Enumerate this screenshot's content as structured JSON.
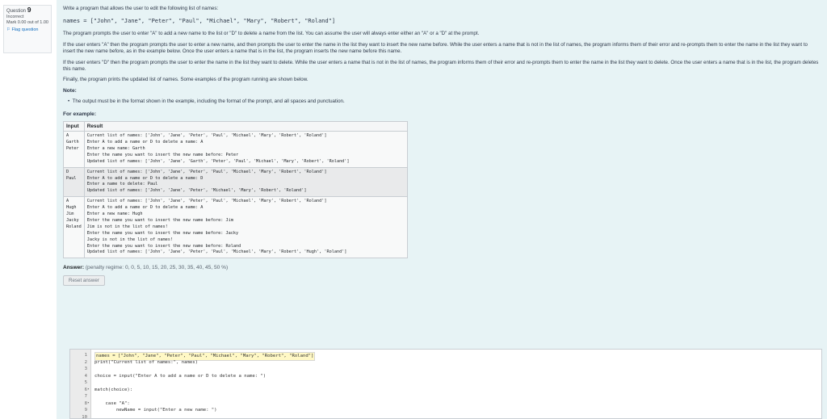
{
  "question_info": {
    "label": "Question",
    "number": "9",
    "status": "Incorrect",
    "mark": "Mark 0.00 out of 1.00",
    "flag_label": "Flag question"
  },
  "question": {
    "intro": "Write a program that allows the user to edit the following list of names:",
    "names_code": "names = [\"John\", \"Jane\", \"Peter\", \"Paul\", \"Michael\", \"Mary\", \"Robert\", \"Roland\"]",
    "para1": "The program prompts the user to enter \"A\" to add a new name to the list or \"D\" to delete a name from the list. You can assume the user will always enter either an \"A\" or a \"D\" at the prompt.",
    "para2": "If the user enters \"A\" then the program prompts the user to enter a new name, and then prompts the user to enter the name in the list they want to insert the new name before. While the user enters a name that is not in the list of names, the program informs them of their error and re-prompts them to enter the name in the list they want to insert the new name before, as in the example below. Once the user enters a name that is in the list, the program inserts the new name before this name.",
    "para3": "If the user enters \"D\" then the program prompts the user to enter the name in the list they want to delete. While the user enters a name that is not in the list of names, the program informs them of their error and re-prompts them to enter the name in the list they want to delete. Once the user enters a name that is in the list, the program deletes this name.",
    "para4": "Finally, the program prints the updated list of names. Some examples of the program running are shown below.",
    "note_label": "Note:",
    "note_bullet": "The output must be in the format shown in the example, including the format of the prompt, and all spaces and punctuation.",
    "example_label": "For example:"
  },
  "examples": {
    "headers": [
      "Input",
      "Result"
    ],
    "rows": [
      {
        "input": "A\nGarth\nPeter",
        "result": "Current list of names: ['John', 'Jane', 'Peter', 'Paul', 'Michael', 'Mary', 'Robert', 'Roland']\nEnter A to add a name or D to delete a name: A\nEnter a new name: Garth\nEnter the name you want to insert the new name before: Peter\nUpdated list of names: ['John', 'Jane', 'Garth', 'Peter', 'Paul', 'Michael', 'Mary', 'Robert', 'Roland']"
      },
      {
        "input": "D\nPaul",
        "result": "Current list of names: ['John', 'Jane', 'Peter', 'Paul', 'Michael', 'Mary', 'Robert', 'Roland']\nEnter A to add a name or D to delete a name: D\nEnter a name to delete: Paul\nUpdated list of names: ['John', 'Jane', 'Peter', 'Michael', 'Mary', 'Robert', 'Roland']"
      },
      {
        "input": "A\nHugh\nJim\nJacky\nRoland",
        "result": "Current list of names: ['John', 'Jane', 'Peter', 'Paul', 'Michael', 'Mary', 'Robert', 'Roland']\nEnter A to add a name or D to delete a name: A\nEnter a new name: Hugh\nEnter the name you want to insert the new name before: Jim\nJim is not in the list of names!\nEnter the name you want to insert the new name before: Jacky\nJacky is not in the list of names!\nEnter the name you want to insert the new name before: Roland\nUpdated list of names: ['John', 'Jane', 'Peter', 'Paul', 'Michael', 'Mary', 'Robert', 'Hugh', 'Roland']"
      }
    ]
  },
  "answer": {
    "label": "Answer:",
    "penalty": "(penalty regime: 0, 0, 5, 10, 15, 20, 25, 30, 35, 40, 45, 50 %)",
    "reset_label": "Reset answer"
  },
  "editor": {
    "lines": [
      {
        "n": "1",
        "fold": "",
        "code": "names = [\"John\", \"Jane\", \"Peter\", \"Paul\", \"Michael\", \"Mary\", \"Robert\", \"Roland\"]"
      },
      {
        "n": "2",
        "fold": "",
        "code": "print(\"Current list of names:\", names)"
      },
      {
        "n": "3",
        "fold": "",
        "code": ""
      },
      {
        "n": "4",
        "fold": "",
        "code": "choice = input(\"Enter A to add a name or D to delete a name: \")"
      },
      {
        "n": "5",
        "fold": "",
        "code": ""
      },
      {
        "n": "6",
        "fold": "▾",
        "code": "match(choice):"
      },
      {
        "n": "7",
        "fold": "",
        "code": ""
      },
      {
        "n": "8",
        "fold": "▾",
        "code": "    case \"A\":"
      },
      {
        "n": "9",
        "fold": "",
        "code": "        newName = input(\"Enter a new name: \")"
      },
      {
        "n": "10",
        "fold": "",
        "code": ""
      }
    ]
  }
}
